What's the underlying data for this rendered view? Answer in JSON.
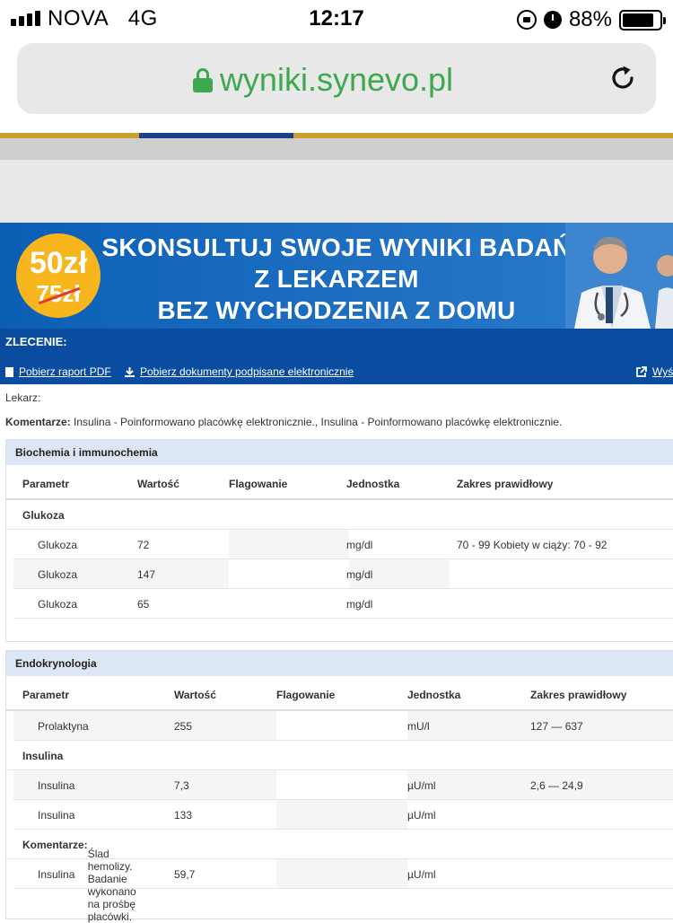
{
  "status_bar": {
    "carrier": "NOVA",
    "network": "4G",
    "time": "12:17",
    "battery": "88%",
    "icons": [
      "signal-icon",
      "orientation-lock-icon",
      "alarm-icon",
      "battery-icon"
    ]
  },
  "browser": {
    "url": "wyniki.synevo.pl",
    "secure_icon": "padlock-icon",
    "reload_icon": "reload-icon",
    "url_color": "#3ca94f"
  },
  "banner": {
    "price_new": "50zł",
    "price_old": "75zł",
    "line1": "SKONSULTUJ SWOJE WYNIKI BADAŃ",
    "line2": "Z LEKARZEM",
    "line3": "BEZ WYCHODZENIA Z DOMU",
    "background": "#0a5fb5",
    "badge_color": "#f7b51e"
  },
  "order": {
    "title": "ZLECENIE:",
    "links": {
      "pdf": "Pobierz raport PDF",
      "signed": "Pobierz dokumenty podpisane elektronicznie",
      "send": "Wyś"
    },
    "bar_color": "#0a4da0"
  },
  "info": {
    "doctor_label": "Lekarz:",
    "comment_label": "Komentarze:",
    "comment_text": " Insulina - Poinformowano placówkę elektronicznie., Insulina - Poinformowano placówkę elektronicznie."
  },
  "panels": [
    {
      "title": "Biochemia i immunochemia",
      "headers": [
        "Parametr",
        "Wartość",
        "Flagowanie",
        "Jednostka",
        "Zakres prawidłowy"
      ],
      "group": "Glukoza",
      "rows": [
        {
          "param": "Glukoza",
          "value": "72",
          "flag": "",
          "unit": "mg/dl",
          "range": "70 - 99 Kobiety w ciąży: 70 - 92"
        },
        {
          "param": "Glukoza",
          "value": "147",
          "flag": "",
          "unit": "mg/dl",
          "range": ""
        },
        {
          "param": "Glukoza",
          "value": "65",
          "flag": "",
          "unit": "mg/dl",
          "range": ""
        }
      ]
    },
    {
      "title": "Endokrynologia",
      "headers": [
        "Parametr",
        "Wartość",
        "Flagowanie",
        "Jednostka",
        "Zakres prawidłowy"
      ],
      "rows_before_group": [
        {
          "param": "Prolaktyna",
          "value": "255",
          "flag": "",
          "unit": "mU/l",
          "range": "127 — 637"
        }
      ],
      "group": "Insulina",
      "rows": [
        {
          "param": "Insulina",
          "value": "7,3",
          "flag": "",
          "unit": "µU/ml",
          "range": "2,6 — 24,9"
        },
        {
          "param": "Insulina",
          "value": "133",
          "flag": "",
          "unit": "µU/ml",
          "range": ""
        }
      ],
      "comment_label": "Komentarze:",
      "comment_text": " Ślad hemolizy. Badanie wykonano na prośbę placówki.",
      "rows_after_comment": [
        {
          "param": "Insulina",
          "value": "59,7",
          "flag": "",
          "unit": "µU/ml",
          "range": ""
        }
      ]
    }
  ]
}
